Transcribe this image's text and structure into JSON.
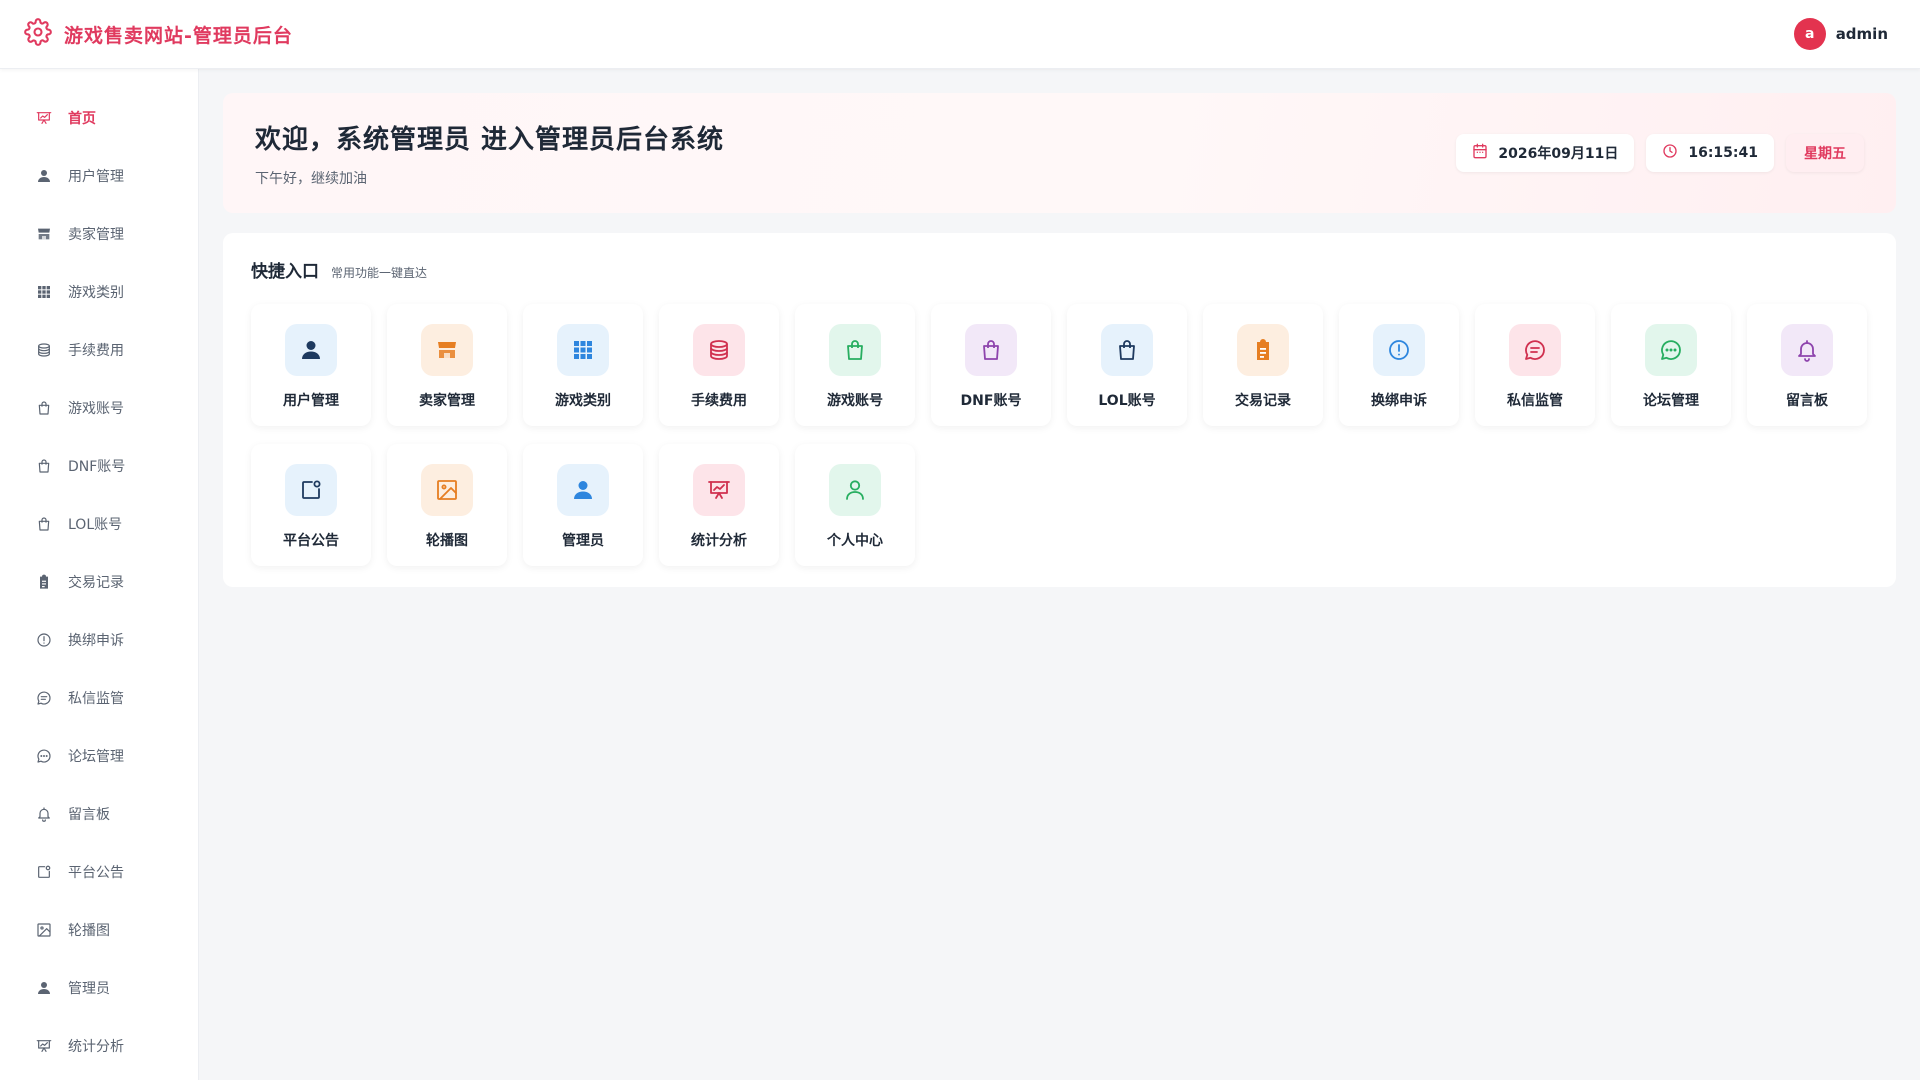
{
  "header": {
    "title": "游戏售卖网站-管理员后台",
    "user_initial": "a",
    "username": "admin"
  },
  "sidebar": {
    "items": [
      {
        "label": "首页",
        "icon": "presentation-icon",
        "active": true
      },
      {
        "label": "用户管理",
        "icon": "user-icon"
      },
      {
        "label": "卖家管理",
        "icon": "shop-icon"
      },
      {
        "label": "游戏类别",
        "icon": "grid-icon"
      },
      {
        "label": "手续费用",
        "icon": "coins-icon"
      },
      {
        "label": "游戏账号",
        "icon": "bag-icon"
      },
      {
        "label": "DNF账号",
        "icon": "bag-icon"
      },
      {
        "label": "LOL账号",
        "icon": "bag-icon"
      },
      {
        "label": "交易记录",
        "icon": "clipboard-icon"
      },
      {
        "label": "换绑申诉",
        "icon": "alert-circle-icon"
      },
      {
        "label": "私信监管",
        "icon": "message-icon"
      },
      {
        "label": "论坛管理",
        "icon": "chat-dots-icon"
      },
      {
        "label": "留言板",
        "icon": "bell-icon"
      },
      {
        "label": "平台公告",
        "icon": "notice-icon"
      },
      {
        "label": "轮播图",
        "icon": "image-icon"
      },
      {
        "label": "管理员",
        "icon": "user-icon"
      },
      {
        "label": "统计分析",
        "icon": "presentation-icon"
      }
    ]
  },
  "welcome": {
    "title": "欢迎，系统管理员 进入管理员后台系统",
    "subtitle": "下午好，继续加油",
    "date": "2026年09月11日",
    "time": "16:15:41",
    "weekday": "星期五"
  },
  "quick": {
    "title": "快捷入口",
    "subtitle": "常用功能一键直达",
    "items": [
      {
        "label": "用户管理",
        "icon": "user-icon",
        "bg": "#e6f2fc",
        "fg": "#1e3a5f"
      },
      {
        "label": "卖家管理",
        "icon": "shop-icon",
        "bg": "#fdeee0",
        "fg": "#e67e22"
      },
      {
        "label": "游戏类别",
        "icon": "grid-icon",
        "bg": "#e6f2fc",
        "fg": "#2e86de"
      },
      {
        "label": "手续费用",
        "icon": "coins-icon",
        "bg": "#fde4e9",
        "fg": "#d0304f"
      },
      {
        "label": "游戏账号",
        "icon": "bag-icon",
        "bg": "#e2f6ec",
        "fg": "#27ae60"
      },
      {
        "label": "DNF账号",
        "icon": "bag-icon",
        "bg": "#f2e8f8",
        "fg": "#8e44ad"
      },
      {
        "label": "LOL账号",
        "icon": "bag-icon",
        "bg": "#e6f2fc",
        "fg": "#1e3a5f"
      },
      {
        "label": "交易记录",
        "icon": "clipboard-icon",
        "bg": "#fdeee0",
        "fg": "#e67e22"
      },
      {
        "label": "换绑申诉",
        "icon": "alert-circle-icon",
        "bg": "#e6f2fc",
        "fg": "#2e86de"
      },
      {
        "label": "私信监管",
        "icon": "message-icon",
        "bg": "#fde4e9",
        "fg": "#d0304f"
      },
      {
        "label": "论坛管理",
        "icon": "chat-dots-icon",
        "bg": "#e2f6ec",
        "fg": "#27ae60"
      },
      {
        "label": "留言板",
        "icon": "bell-icon",
        "bg": "#f2e8f8",
        "fg": "#8e44ad"
      },
      {
        "label": "平台公告",
        "icon": "notice-icon",
        "bg": "#e6f2fc",
        "fg": "#1e3a5f"
      },
      {
        "label": "轮播图",
        "icon": "image-icon",
        "bg": "#fdeee0",
        "fg": "#e67e22"
      },
      {
        "label": "管理员",
        "icon": "user-icon",
        "bg": "#e6f2fc",
        "fg": "#2e86de"
      },
      {
        "label": "统计分析",
        "icon": "presentation-icon",
        "bg": "#fde4e9",
        "fg": "#d0304f"
      },
      {
        "label": "个人中心",
        "icon": "user-outline-icon",
        "bg": "#e2f6ec",
        "fg": "#27ae60"
      }
    ]
  },
  "colors": {
    "accent": "#e03a5f",
    "sidebar_text": "#5b6472"
  }
}
